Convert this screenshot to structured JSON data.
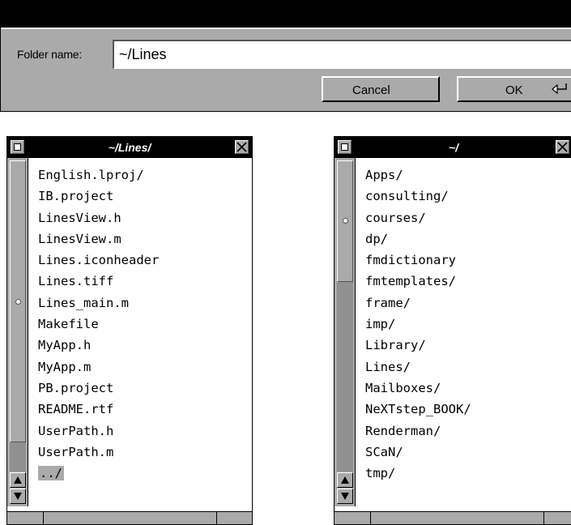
{
  "folder_panel": {
    "label": "Folder name:",
    "value": "~/Lines",
    "cancel_label": "Cancel",
    "ok_label": "OK",
    "ok_icon": "return-key-icon"
  },
  "left_browser": {
    "title": "~/Lines/",
    "items": [
      "English.lproj/",
      "IB.project",
      "LinesView.h",
      "LinesView.m",
      "Lines.iconheader",
      "Lines.tiff",
      "Lines_main.m",
      "Makefile",
      "MyApp.h",
      "MyApp.m",
      "PB.project",
      "README.rtf",
      "UserPath.h",
      "UserPath.m",
      "../"
    ],
    "selected_item": "../"
  },
  "right_browser": {
    "title": "~/",
    "items": [
      "Apps/",
      "consulting/",
      "courses/",
      "dp/",
      "fmdictionary",
      "fmtemplates/",
      "frame/",
      "imp/",
      "Library/",
      "Lines/",
      "Mailboxes/",
      "NeXTstep_BOOK/",
      "Renderman/",
      "SCaN/",
      "tmp/"
    ]
  },
  "colors": {
    "chrome_gray": "#aaaaaa",
    "titlebar": "#000000",
    "selection": "#aaaaaa"
  }
}
